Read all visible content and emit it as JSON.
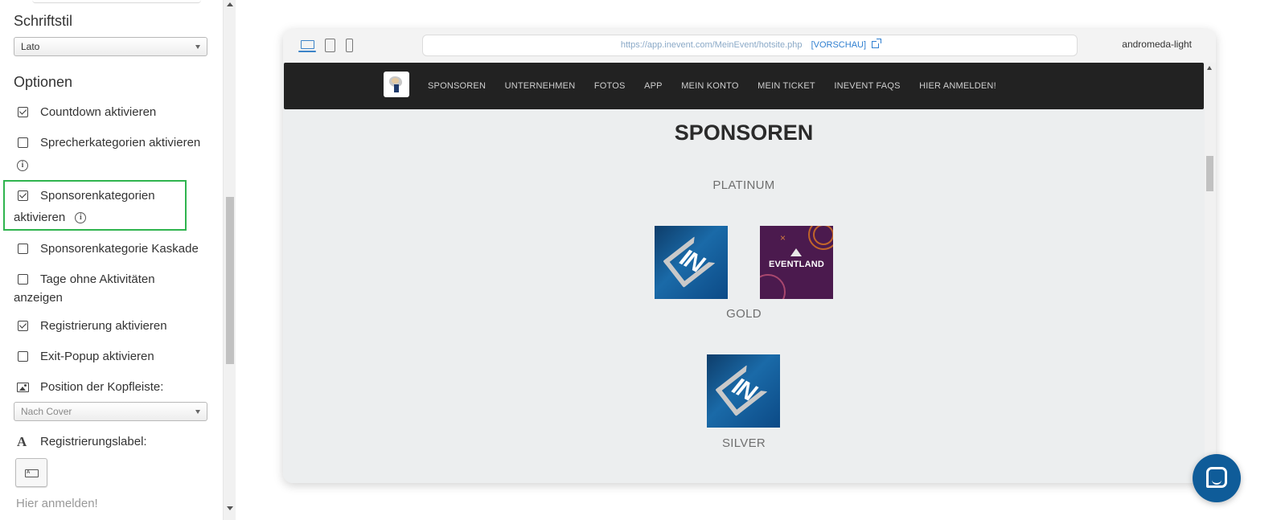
{
  "sidebar": {
    "font_section_title": "Schriftstil",
    "font_select_value": "Lato",
    "options_section_title": "Optionen",
    "options": [
      {
        "label": "Countdown aktivieren",
        "checked": true
      },
      {
        "label": "Sprecherkategorien aktivieren",
        "checked": false
      },
      {
        "label": "Sponsorenkategorien aktivieren",
        "checked": true
      },
      {
        "label": "Sponsorenkategorie Kaskade",
        "checked": false
      },
      {
        "label": "Tage ohne Aktivitäten anzeigen",
        "checked": false
      },
      {
        "label": "Registrierung aktivieren",
        "checked": true
      },
      {
        "label": "Exit-Popup aktivieren",
        "checked": false
      }
    ],
    "option_lines": {
      "sprecher_1": "Sprecherkategorien aktivieren",
      "sponsoren_1": "Sponsorenkategorien",
      "sponsoren_2": "aktivieren",
      "tage_1": "Tage ohne Aktivitäten",
      "tage_2": "anzeigen"
    },
    "header_position_label": "Position der Kopfleiste:",
    "header_position_value": "Nach Cover",
    "registration_label_title": "Registrierungslabel:",
    "registration_label_value": "Hier anmelden!",
    "highlight_color": "#2fb44e"
  },
  "preview": {
    "url": "https://app.inevent.com/MeinEvent/hotsite.php",
    "preview_label": "[VORSCHAU]",
    "theme_name": "andromeda-light",
    "devices": [
      "laptop-icon",
      "tablet-icon",
      "phone-icon"
    ],
    "active_device": "laptop-icon"
  },
  "site": {
    "nav": [
      "SPONSOREN",
      "UNTERNEHMEN",
      "FOTOS",
      "APP",
      "MEIN KONTO",
      "MEIN TICKET",
      "INEVENT FAQS",
      "HIER ANMELDEN!"
    ],
    "title": "SPONSOREN",
    "tiers": [
      "PLATINUM",
      "GOLD",
      "SILVER"
    ],
    "sponsors": {
      "platinum": [
        "inevent-logo",
        "eventland-logo"
      ],
      "gold": [
        "inevent-logo"
      ]
    },
    "logo_in_text": "IN",
    "logo_eventland_text": "EVENTLAND",
    "logo_eventland_mark": "×",
    "nav_bg": "#222222"
  },
  "chat": {
    "icon": "chat-bubble-icon",
    "color": "#0f5c99"
  }
}
